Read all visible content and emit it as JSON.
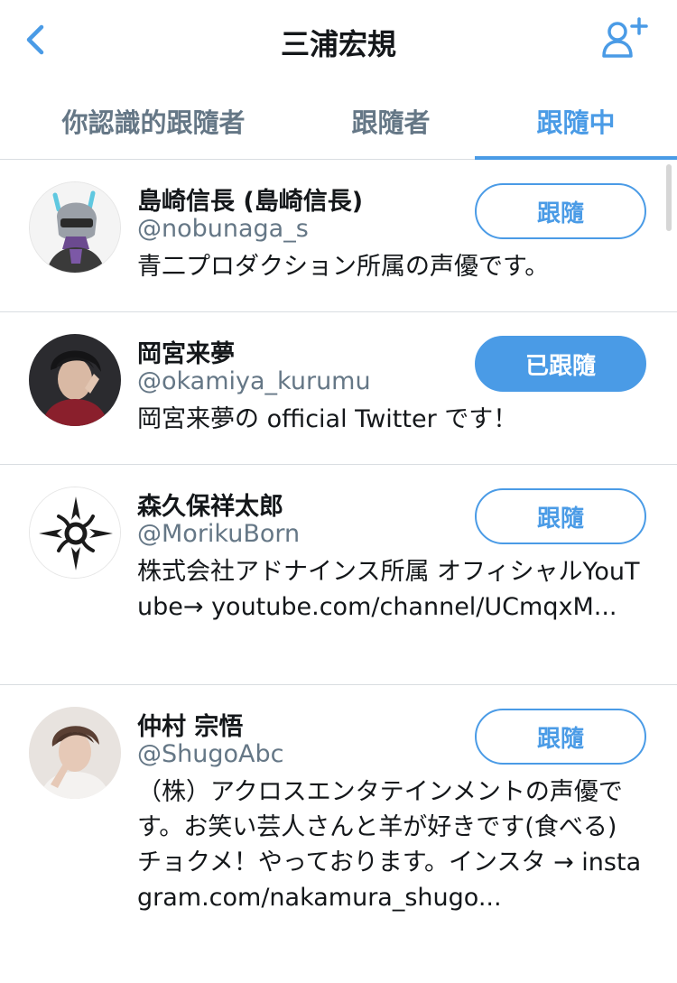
{
  "header": {
    "title": "三浦宏規",
    "back_icon": "chevron-left-icon",
    "add_icon": "add-user-icon"
  },
  "tabs": [
    {
      "label": "你認識的跟隨者",
      "active": false
    },
    {
      "label": "跟隨者",
      "active": false
    },
    {
      "label": "跟隨中",
      "active": true
    }
  ],
  "users": [
    {
      "name": "島崎信長 (島崎信長)",
      "handle": "@nobunaga_s",
      "bio": "青二プロダクション所属の声優です。",
      "button": "跟隨",
      "following": false
    },
    {
      "name": "岡宮来夢",
      "handle": "@okamiya_kurumu",
      "bio": "岡宮来夢の official Twitter です！",
      "button": "已跟隨",
      "following": true
    },
    {
      "name": "森久保祥太郎",
      "handle": "@MorikuBorn",
      "bio": "株式会社アドナインス所属 オフィシャルYouTube→ youtube.com/channel/UCmqxM...",
      "button": "跟隨",
      "following": false
    },
    {
      "name": "仲村 宗悟",
      "handle": "@ShugoAbc",
      "bio": "（株）アクロスエンタテインメントの声優です。お笑い芸人さんと羊が好きです(食べる) チョクメ！やっております。インスタ → instagram.com/nakamura_shugo...",
      "button": "跟隨",
      "following": false
    }
  ],
  "colors": {
    "accent": "#4a9be6",
    "secondary_text": "#657786",
    "divider": "#d9dde1"
  }
}
